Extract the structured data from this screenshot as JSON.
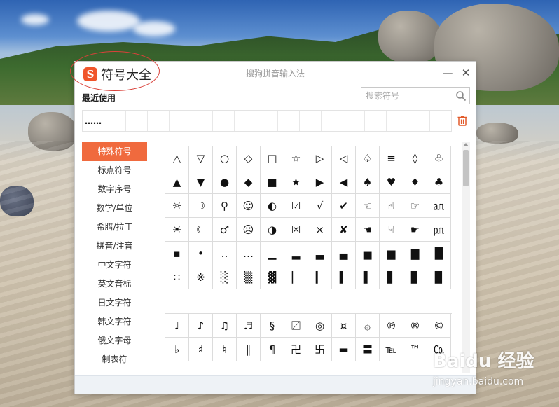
{
  "window": {
    "app_title": "符号大全",
    "center_title": "搜狗拼音输入法",
    "logo_letter": "S",
    "minimize_label": "—",
    "close_label": "✕"
  },
  "recent": {
    "label": "最近使用",
    "cells": [
      "……",
      "",
      "",
      "",
      "",
      "",
      "",
      "",
      "",
      "",
      "",
      "",
      "",
      "",
      "",
      "",
      ""
    ]
  },
  "search": {
    "placeholder": "搜索符号",
    "value": ""
  },
  "sidebar": {
    "items": [
      {
        "label": "特殊符号",
        "active": true
      },
      {
        "label": "标点符号",
        "active": false
      },
      {
        "label": "数字序号",
        "active": false
      },
      {
        "label": "数学/单位",
        "active": false
      },
      {
        "label": "希腊/拉丁",
        "active": false
      },
      {
        "label": "拼音/注音",
        "active": false
      },
      {
        "label": "中文字符",
        "active": false
      },
      {
        "label": "英文音标",
        "active": false
      },
      {
        "label": "日文字符",
        "active": false
      },
      {
        "label": "韩文字符",
        "active": false
      },
      {
        "label": "俄文字母",
        "active": false
      },
      {
        "label": "制表符",
        "active": false
      }
    ]
  },
  "symbols": {
    "group1": [
      [
        "△",
        "▽",
        "○",
        "◇",
        "□",
        "☆",
        "▷",
        "◁",
        "♤",
        "≡",
        "◊",
        "♧"
      ],
      [
        "▲",
        "▼",
        "●",
        "◆",
        "■",
        "★",
        "▶",
        "◀",
        "♠",
        "♥",
        "♦",
        "♣"
      ],
      [
        "☼",
        "☽",
        "♀",
        "☺",
        "◐",
        "☑",
        "√",
        "✔",
        "☜",
        "☝",
        "☞",
        "㏂"
      ],
      [
        "☀",
        "☾",
        "♂",
        "☹",
        "◑",
        "☒",
        "×",
        "✘",
        "☚",
        "☟",
        "☛",
        "㏘"
      ],
      [
        "▪",
        "•",
        "‥",
        "…",
        "▁",
        "▂",
        "▃",
        "▄",
        "▅",
        "▆",
        "▇",
        "█"
      ],
      [
        "∷",
        "※",
        "░",
        "▒",
        "▓",
        "▏",
        "▎",
        "▍",
        "▌",
        "▋",
        "▊",
        "▉"
      ]
    ],
    "group2": [
      [
        "♩",
        "♪",
        "♫",
        "♬",
        "§",
        "〼",
        "◎",
        "¤",
        "۞",
        "℗",
        "®",
        "©"
      ],
      [
        "♭",
        "♯",
        "♮",
        "‖",
        "¶",
        "卍",
        "卐",
        "▬",
        "〓",
        "℡",
        "™",
        "㏇"
      ]
    ]
  },
  "watermark": {
    "main": "Baidu 经验",
    "sub": "jingyan.baidu.com"
  },
  "colors": {
    "accent": "#f06a3e",
    "logo": "#f0552b",
    "annotation": "#d9413a"
  }
}
